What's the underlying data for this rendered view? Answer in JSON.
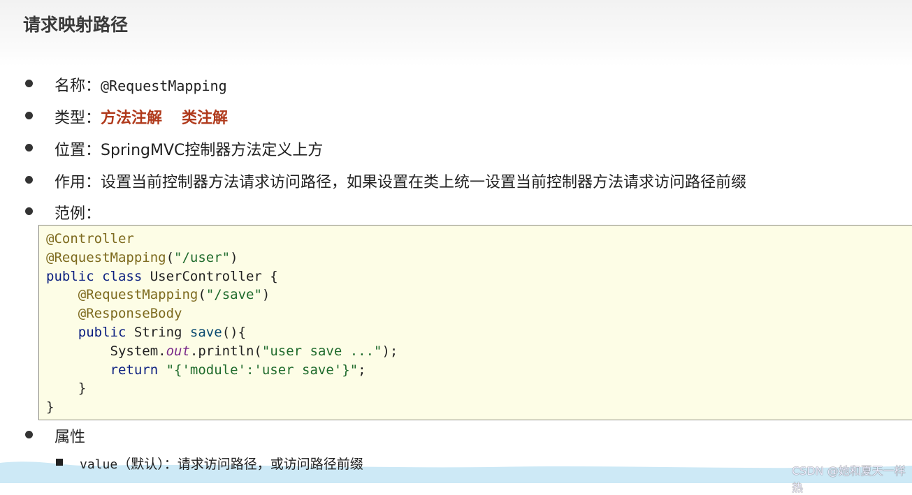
{
  "title": "请求映射路径",
  "items": [
    {
      "label": "名称：",
      "value": "@RequestMapping"
    },
    {
      "label": "类型：",
      "values": [
        "方法注解",
        "类注解"
      ]
    },
    {
      "label": "位置：",
      "value": "SpringMVC控制器方法定义上方"
    },
    {
      "label": "作用：",
      "value": "设置当前控制器方法请求访问路径，如果设置在类上统一设置当前控制器方法请求访问路径前缀"
    },
    {
      "label": "范例："
    },
    {
      "label": "属性"
    }
  ],
  "code": {
    "l1": "@Controller",
    "l2a": "@RequestMapping",
    "l2b": "(",
    "l2c": "\"/user\"",
    "l2d": ")",
    "l3a": "public class ",
    "l3b": "UserController {",
    "l4a": "@RequestMapping",
    "l4b": "(",
    "l4c": "\"/save\"",
    "l4d": ")",
    "l5": "@ResponseBody",
    "l6a": "public ",
    "l6b": "String ",
    "l6c": "save",
    "l6d": "(){",
    "l7a": "System.",
    "l7b": "out",
    "l7c": ".println(",
    "l7d": "\"user save ...\"",
    "l7e": ");",
    "l8a": "return ",
    "l8b": "\"{'module':'user save'}\"",
    "l8c": ";",
    "l9": "}",
    "l10": "}"
  },
  "sub_items": [
    {
      "name": "value",
      "desc": "（默认）：请求访问路径，或访问路径前缀"
    }
  ],
  "watermark": "CSDN @她和夏天一样热"
}
